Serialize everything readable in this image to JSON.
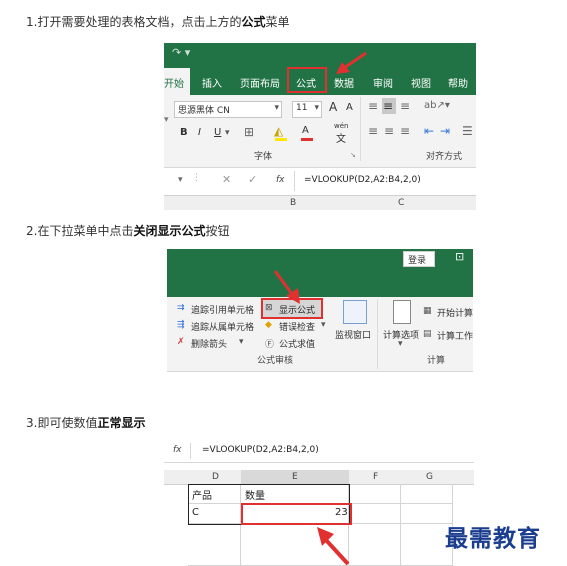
{
  "step1": {
    "prefix": "1.打开需要处理的表格文档，点击上方的",
    "bold": "公式",
    "suffix": "菜单"
  },
  "step2": {
    "prefix": "2.在下拉菜单中点击",
    "bold": "关闭显示公式",
    "suffix": "按钮"
  },
  "step3": {
    "prefix": "3.即可使数值",
    "bold": "正常显示",
    "suffix": ""
  },
  "shot1": {
    "tabs": [
      "开始",
      "插入",
      "页面布局",
      "公式",
      "数据",
      "审阅",
      "视图",
      "帮助"
    ],
    "font_name": "思源黑体 CN",
    "font_size": "11",
    "grow_font": "A",
    "shrink_font": "A",
    "bold": "B",
    "italic": "I",
    "underline": "U",
    "font_color_letter": "A",
    "wen": "wén",
    "wen_char": "文",
    "group_font": "字体",
    "group_align": "对齐方式",
    "fx": "fx",
    "formula": "=VLOOKUP(D2,A2:B4,2,0)",
    "col_b": "B",
    "col_c": "C"
  },
  "shot2": {
    "login": "登录",
    "trace_precedents": "追踪引用单元格",
    "trace_dependents": "追踪从属单元格",
    "remove_arrows": "删除箭头",
    "show_formulas": "显示公式",
    "error_checking": "错误检查",
    "evaluate_formula": "公式求值",
    "watch_window": "监视窗口",
    "calc_options": "计算选项",
    "calc_now": "开始计算",
    "calc_sheet": "计算工作",
    "group_audit": "公式审核",
    "group_calc": "计算"
  },
  "shot3": {
    "fx": "fx",
    "formula": "=VLOOKUP(D2,A2:B4,2,0)",
    "cols": [
      "D",
      "E",
      "F",
      "G"
    ],
    "header_d": "产品",
    "header_e": "数量",
    "val_d": "C",
    "val_e": "23"
  },
  "watermark": "最需教育",
  "colors": {
    "excel_green": "#217346",
    "highlight_red": "#e03030",
    "watermark_blue": "#1a3d8f"
  }
}
